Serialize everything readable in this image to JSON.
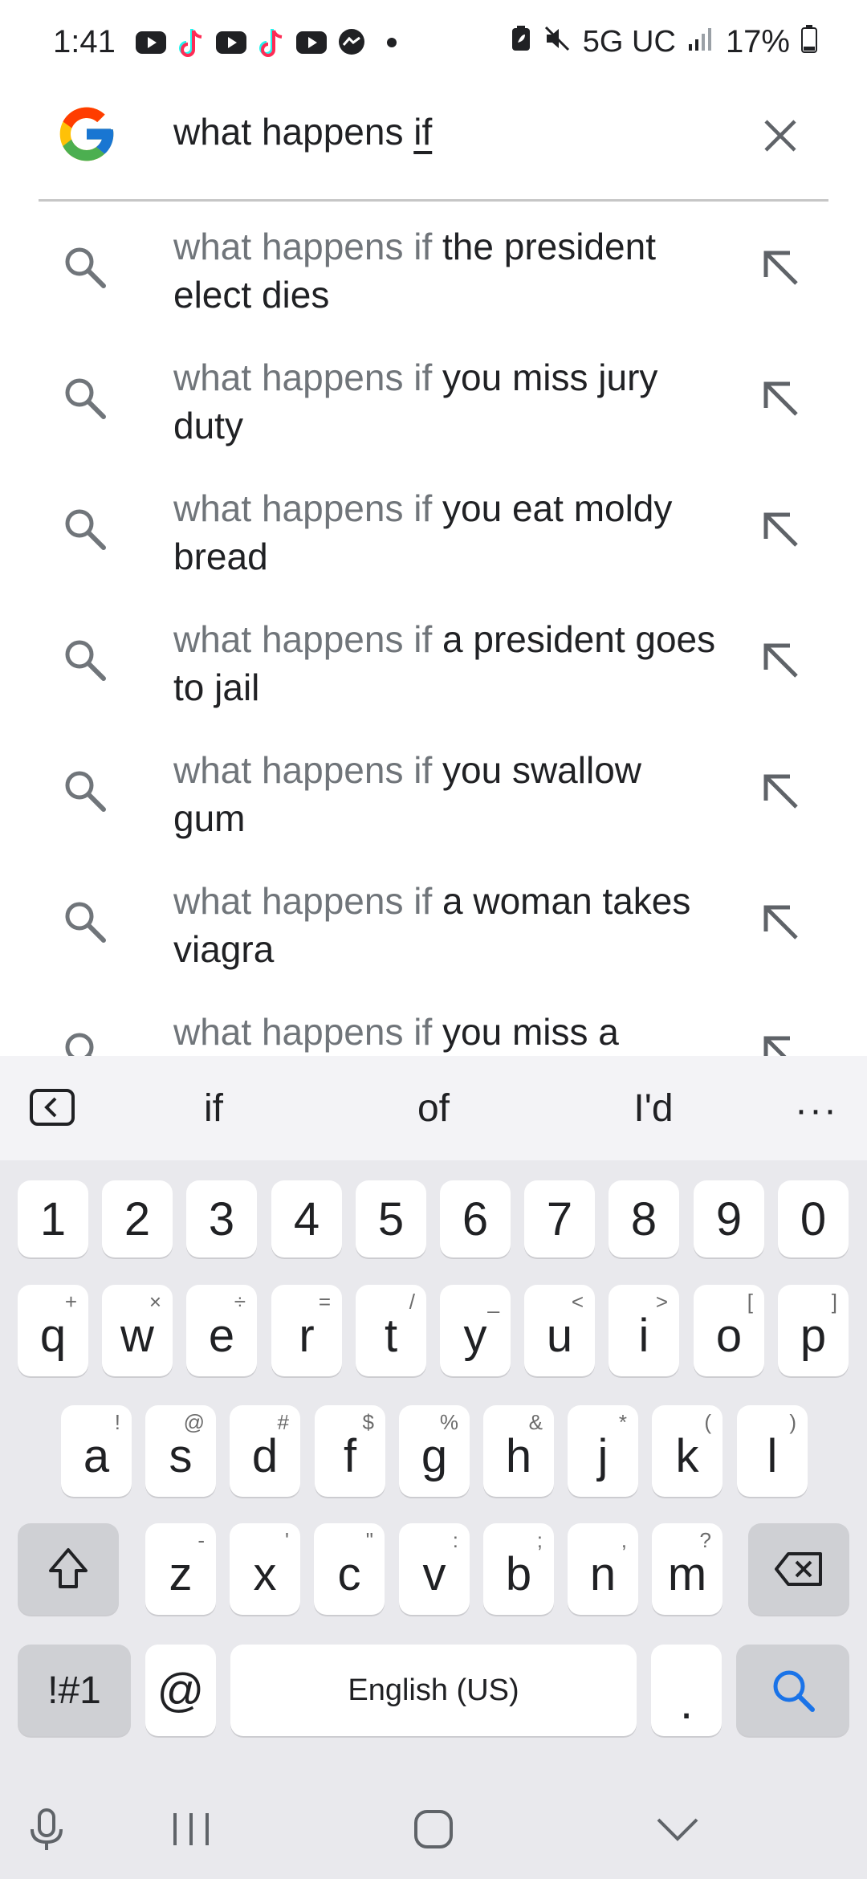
{
  "status_bar": {
    "time": "1:41",
    "network": "5G UC",
    "battery": "17%",
    "notification_icons": [
      "youtube-icon",
      "tiktok-icon",
      "youtube-icon",
      "tiktok-icon",
      "youtube-icon",
      "messenger-icon",
      "dot-icon"
    ],
    "right_icons": [
      "battery-saver-icon",
      "mute-icon",
      "signal-icon",
      "battery-icon"
    ]
  },
  "search": {
    "query_prefix": "what happens ",
    "query_underlined": "if",
    "logo": "google-g-icon",
    "clear_icon": "close-icon"
  },
  "suggestions": [
    {
      "prefix": "what happens if ",
      "completion": "the president elect dies"
    },
    {
      "prefix": "what happens if ",
      "completion": "you miss jury duty"
    },
    {
      "prefix": "what happens if ",
      "completion": "you eat moldy bread"
    },
    {
      "prefix": "what happens if ",
      "completion": "a president goes to jail"
    },
    {
      "prefix": "what happens if ",
      "completion": "you swallow gum"
    },
    {
      "prefix": "what happens if ",
      "completion": "a woman takes viagra"
    },
    {
      "prefix": "what happens if ",
      "completion": "you miss a"
    }
  ],
  "keyboard": {
    "predictions": [
      "if",
      "of",
      "I'd"
    ],
    "more": "···",
    "number_row": [
      "1",
      "2",
      "3",
      "4",
      "5",
      "6",
      "7",
      "8",
      "9",
      "0"
    ],
    "row1": [
      {
        "key": "q",
        "sub": "+"
      },
      {
        "key": "w",
        "sub": "×"
      },
      {
        "key": "e",
        "sub": "÷"
      },
      {
        "key": "r",
        "sub": "="
      },
      {
        "key": "t",
        "sub": "/"
      },
      {
        "key": "y",
        "sub": "_"
      },
      {
        "key": "u",
        "sub": "<"
      },
      {
        "key": "i",
        "sub": ">"
      },
      {
        "key": "o",
        "sub": "["
      },
      {
        "key": "p",
        "sub": "]"
      }
    ],
    "row2": [
      {
        "key": "a",
        "sub": "!"
      },
      {
        "key": "s",
        "sub": "@"
      },
      {
        "key": "d",
        "sub": "#"
      },
      {
        "key": "f",
        "sub": "$"
      },
      {
        "key": "g",
        "sub": "%"
      },
      {
        "key": "h",
        "sub": "&"
      },
      {
        "key": "j",
        "sub": "*"
      },
      {
        "key": "k",
        "sub": "("
      },
      {
        "key": "l",
        "sub": ")"
      }
    ],
    "row3": [
      {
        "key": "z",
        "sub": "-"
      },
      {
        "key": "x",
        "sub": "'"
      },
      {
        "key": "c",
        "sub": "\""
      },
      {
        "key": "v",
        "sub": ":"
      },
      {
        "key": "b",
        "sub": ";"
      },
      {
        "key": "n",
        "sub": ","
      },
      {
        "key": "m",
        "sub": "?"
      }
    ],
    "symbols_label": "!#1",
    "at_label": "@",
    "space_label": "English (US)",
    "period_label": ".",
    "accent_color": "#1a73e8"
  },
  "nav_bar": {
    "icons": [
      "microphone-icon",
      "recent-apps-icon",
      "home-icon",
      "hide-keyboard-icon"
    ]
  }
}
